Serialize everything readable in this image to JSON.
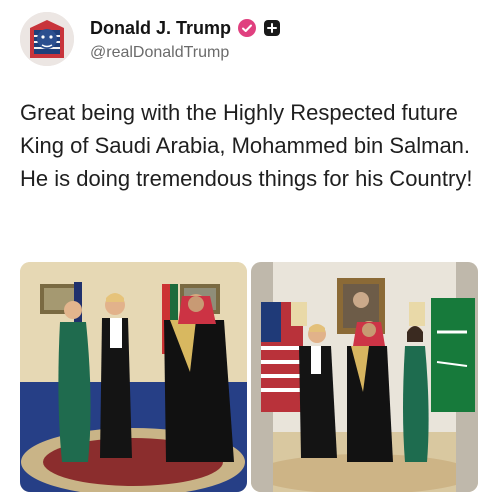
{
  "author": {
    "display_name": "Donald J. Trump",
    "handle": "@realDonaldTrump",
    "avatar_icon": "profile-portrait-icon",
    "verified_icon": "verified-badge-icon",
    "plus_icon": "plus-square-icon",
    "verified_color": "#e0407f"
  },
  "post": {
    "text": "Great being with the Highly Respected future King of Saudi Arabia, Mohammed bin Salman. He is doing tremendous things for his Country!"
  },
  "media": {
    "count": 2,
    "images": [
      "photo-left",
      "photo-right"
    ]
  },
  "colors": {
    "text": "#1f1f1f",
    "handle": "#6b6b6b"
  }
}
